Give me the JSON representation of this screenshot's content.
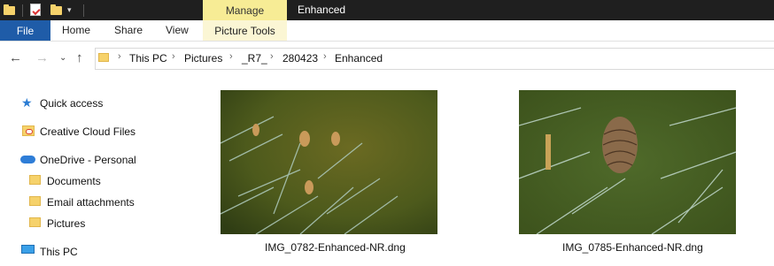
{
  "window": {
    "context_tab": "Manage",
    "title": "Enhanced"
  },
  "ribbon": {
    "tabs": [
      "File",
      "Home",
      "Share",
      "View",
      "Picture Tools"
    ]
  },
  "address": {
    "crumbs": [
      "This PC",
      "Pictures",
      "_R7_",
      "280423",
      "Enhanced"
    ]
  },
  "sidebar": {
    "quick_access": "Quick access",
    "creative_cloud": "Creative Cloud Files",
    "onedrive": "OneDrive - Personal",
    "folders": [
      "Documents",
      "Email attachments",
      "Pictures"
    ],
    "this_pc": "This PC"
  },
  "files": [
    {
      "name": "IMG_0782-Enhanced-NR.dng"
    },
    {
      "name": "IMG_0785-Enhanced-NR.dng"
    }
  ],
  "colors": {
    "titlebar": "#1f1f1f",
    "manage_accent": "#f7ec95",
    "file_tab": "#1f5ca8"
  }
}
